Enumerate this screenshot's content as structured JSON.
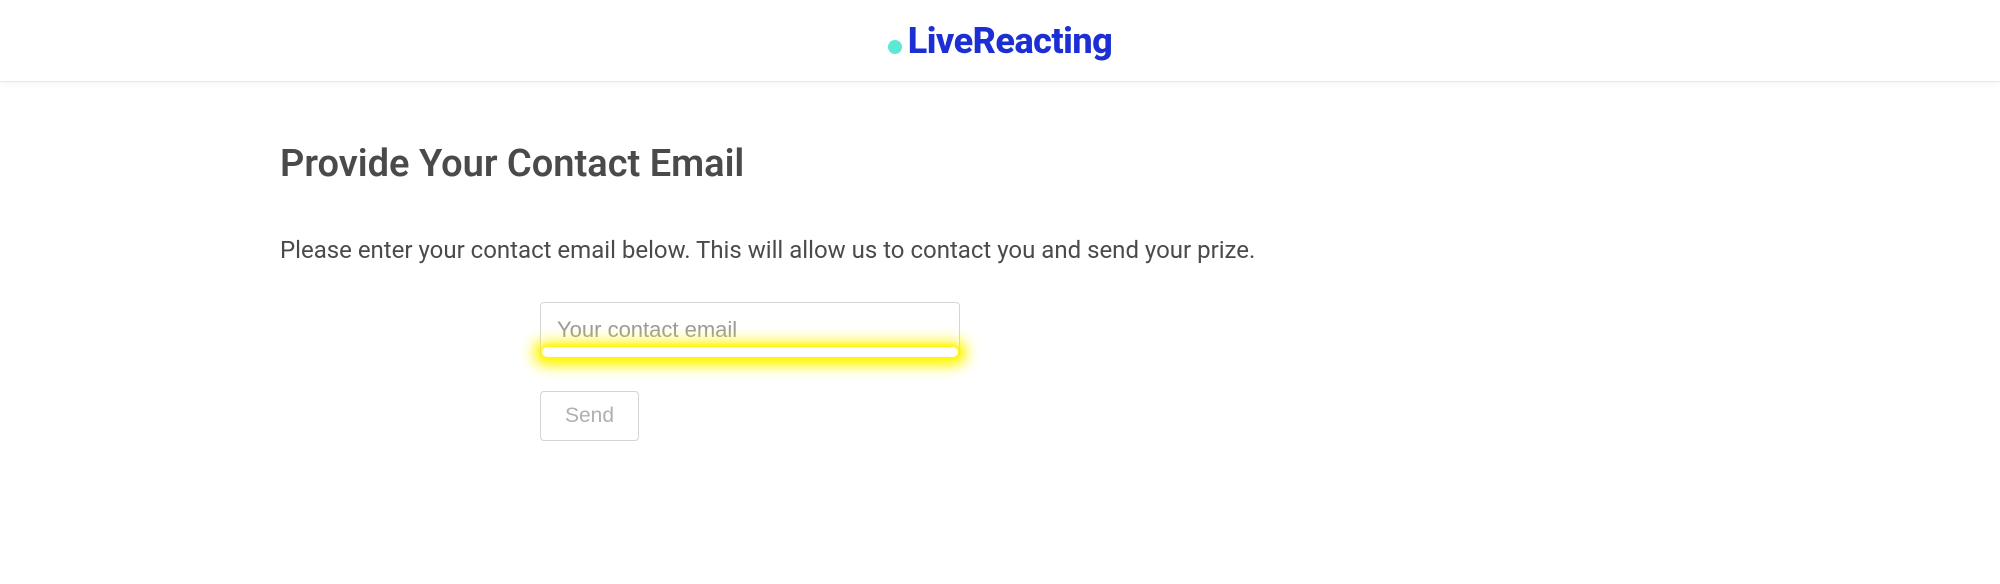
{
  "header": {
    "brand_name": "LiveReacting"
  },
  "form": {
    "title": "Provide Your Contact Email",
    "description": "Please enter your contact email below. This will allow us to contact you and send your prize.",
    "email_placeholder": "Your contact email",
    "email_value": "",
    "send_label": "Send"
  }
}
